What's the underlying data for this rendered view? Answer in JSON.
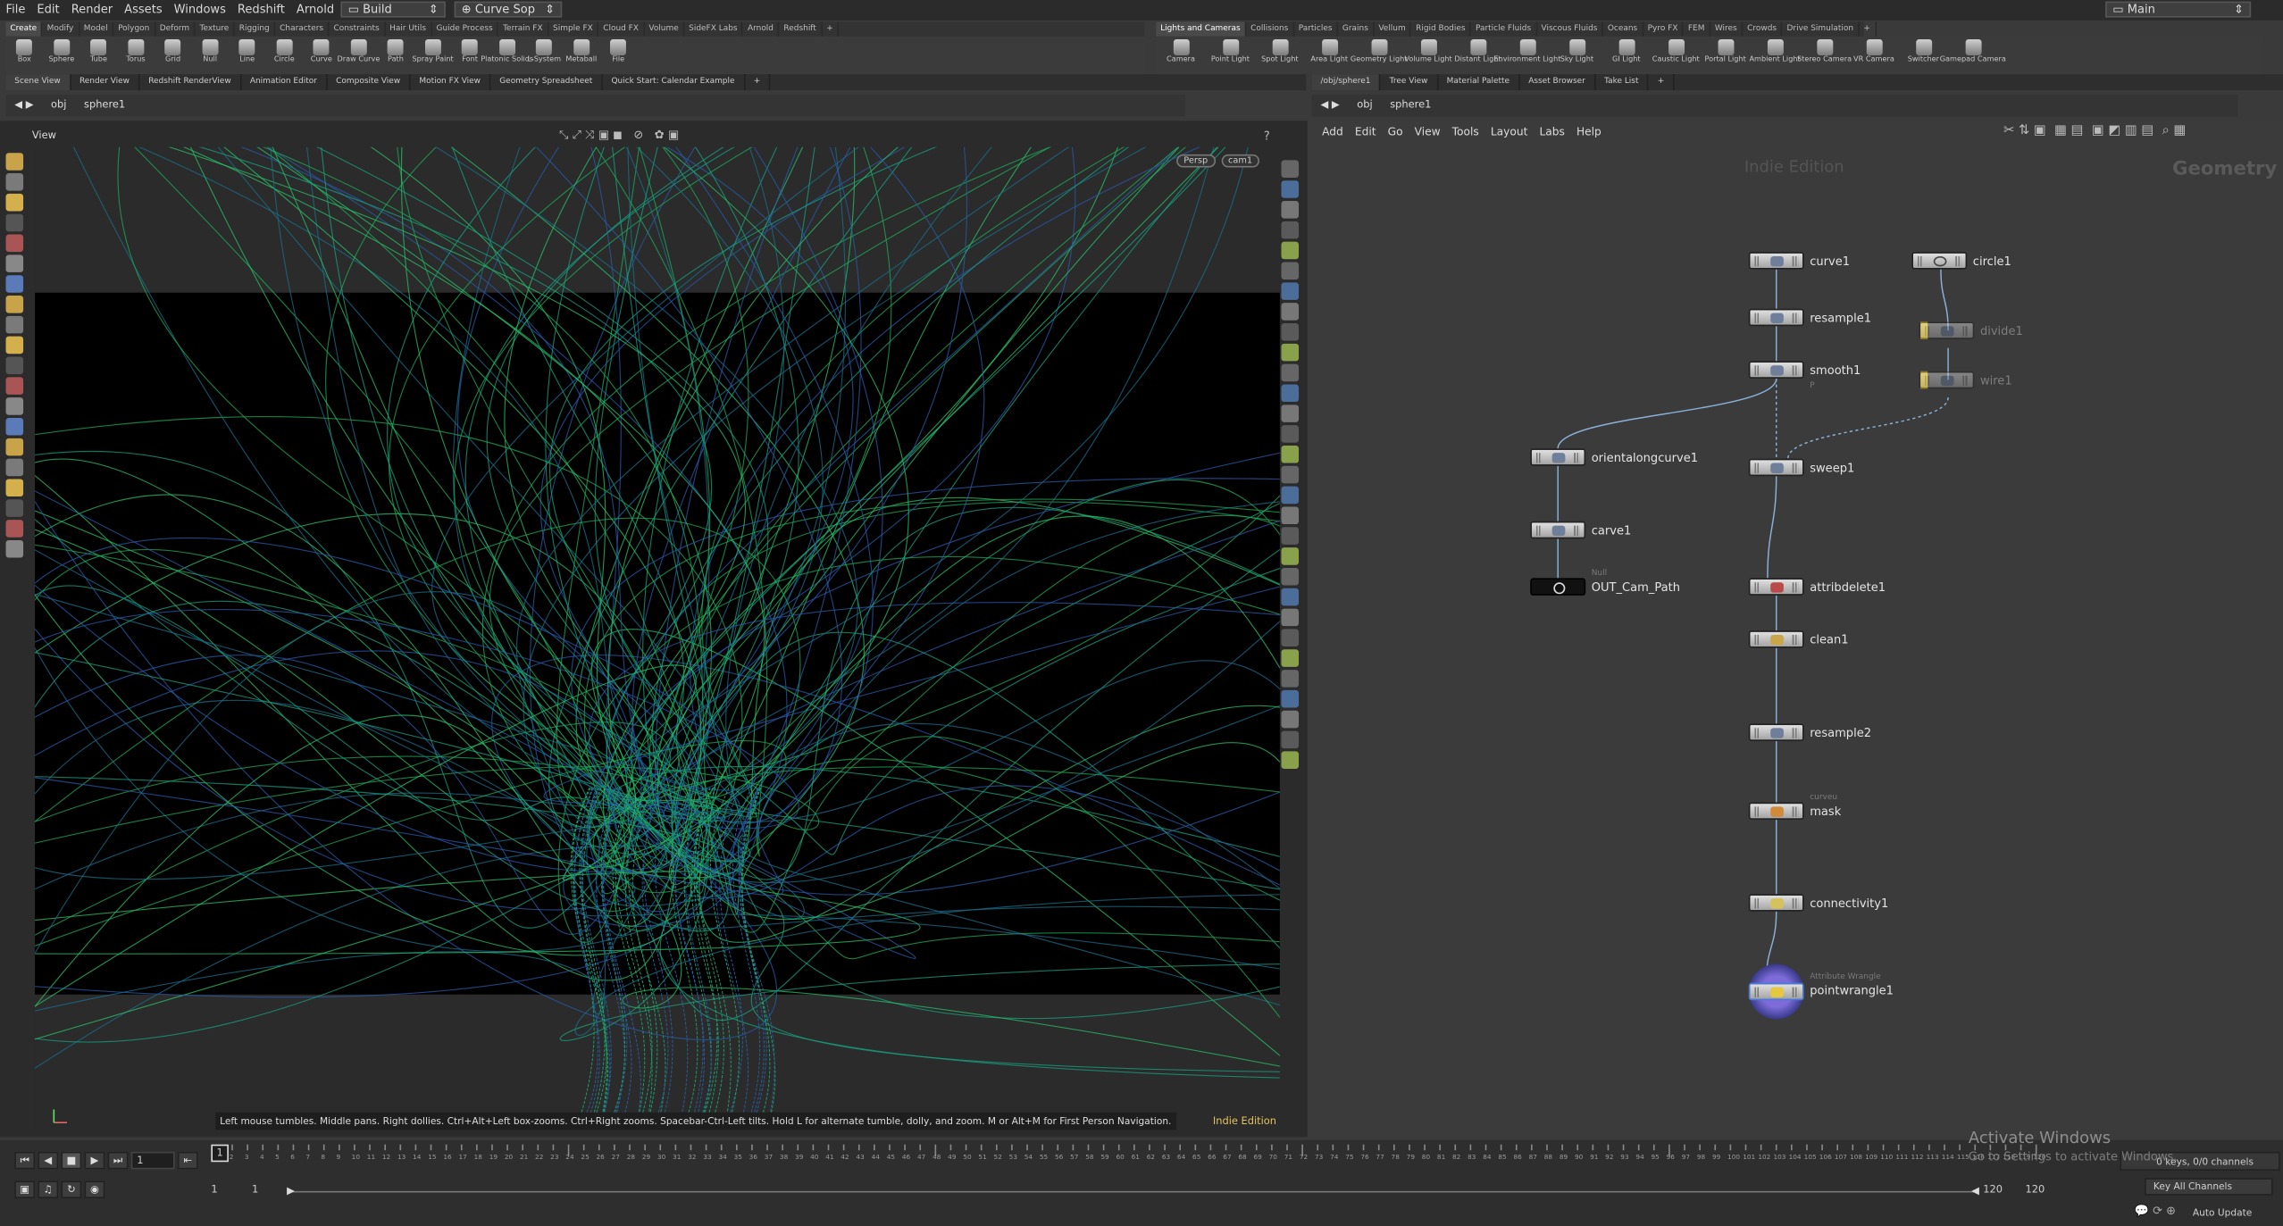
{
  "menubar": {
    "items": [
      "File",
      "Edit",
      "Render",
      "Assets",
      "Windows",
      "Redshift",
      "Arnold",
      "Help"
    ],
    "desktop": "Build",
    "context": "Curve Sop",
    "main": "Main"
  },
  "shelf_left": {
    "tabs": [
      "Create",
      "Modify",
      "Model",
      "Polygon",
      "Deform",
      "Texture",
      "Rigging",
      "Characters",
      "Constraints",
      "Hair Utils",
      "Guide Process",
      "Terrain FX",
      "Simple FX",
      "Cloud FX",
      "Volume",
      "SideFX Labs",
      "Arnold",
      "Redshift"
    ],
    "tools": [
      "Box",
      "Sphere",
      "Tube",
      "Torus",
      "Grid",
      "Null",
      "Line",
      "Circle",
      "Curve",
      "Draw Curve",
      "Path",
      "Spray Paint",
      "Font",
      "Platonic Solids",
      "L-System",
      "Metaball",
      "File"
    ]
  },
  "shelf_right": {
    "tabs": [
      "Lights and Cameras",
      "Collisions",
      "Particles",
      "Grains",
      "Vellum",
      "Rigid Bodies",
      "Particle Fluids",
      "Viscous Fluids",
      "Oceans",
      "Pyro FX",
      "FEM",
      "Wires",
      "Crowds",
      "Drive Simulation"
    ],
    "tools": [
      "Camera",
      "Point Light",
      "Spot Light",
      "Area Light",
      "Geometry Light",
      "Volume Light",
      "Distant Light",
      "Environment Light",
      "Sky Light",
      "GI Light",
      "Caustic Light",
      "Portal Light",
      "Ambient Light",
      "Stereo Camera",
      "VR Camera",
      "Switcher",
      "Gamepad Camera"
    ]
  },
  "left_panes": {
    "tabs": [
      "Scene View",
      "Render View",
      "Redshift RenderView",
      "Animation Editor",
      "Composite View",
      "Motion FX View",
      "Geometry Spreadsheet",
      "Quick Start: Calendar Example"
    ],
    "path": [
      "obj",
      "sphere1"
    ]
  },
  "right_panes": {
    "tabs": [
      "/obj/sphere1",
      "Tree View",
      "Material Palette",
      "Asset Browser",
      "Take List"
    ],
    "path": [
      "obj",
      "sphere1"
    ]
  },
  "viewport": {
    "title": "View",
    "persp": "Persp",
    "camera": "cam1",
    "hint": "Left mouse tumbles. Middle pans. Right dollies. Ctrl+Alt+Left box-zooms. Ctrl+Right zooms. Spacebar-Ctrl-Left tilts. Hold L for alternate tumble, dolly, and zoom.    M or Alt+M for First Person Navigation.",
    "edition": "Indie Edition"
  },
  "network": {
    "menu": [
      "Add",
      "Edit",
      "Go",
      "View",
      "Tools",
      "Layout",
      "Labs",
      "Help"
    ],
    "watermark": "Indie Edition",
    "context": "Geometry",
    "nodes": {
      "curve1": "curve1",
      "resample1": "resample1",
      "smooth1": "smooth1",
      "smooth1_flag": "P",
      "circle1": "circle1",
      "divide1": "divide1",
      "wire1": "wire1",
      "orient": "orientalongcurve1",
      "carve1": "carve1",
      "null_type": "Null",
      "out": "OUT_Cam_Path",
      "sweep1": "sweep1",
      "attribdelete1": "attribdelete1",
      "clean1": "clean1",
      "resample2": "resample2",
      "mask_type": "curveu",
      "mask": "mask",
      "connectivity1": "connectivity1",
      "wrangle_type": "Attribute Wrangle",
      "wrangle": "pointwrangle1"
    }
  },
  "timeline": {
    "frame": "1",
    "start": "1",
    "start2": "1",
    "end": "120",
    "end2": "120",
    "ticks": [
      "1",
      "2",
      "3",
      "4",
      "5",
      "6",
      "7",
      "8",
      "9",
      "10",
      "11",
      "12",
      "13",
      "14",
      "15",
      "16",
      "17",
      "18",
      "19",
      "20",
      "21",
      "22",
      "23",
      "24",
      "25",
      "26",
      "27",
      "28",
      "29",
      "30",
      "31",
      "32",
      "33",
      "34",
      "35",
      "36",
      "37",
      "38",
      "39",
      "40",
      "41",
      "42",
      "43",
      "44",
      "45",
      "46",
      "47",
      "48",
      "49",
      "50",
      "51",
      "52",
      "53",
      "54",
      "55",
      "56",
      "57",
      "58",
      "59",
      "60",
      "61",
      "62",
      "63",
      "64",
      "65",
      "66",
      "67",
      "68",
      "69",
      "70",
      "71",
      "72",
      "73",
      "74",
      "75",
      "76",
      "77",
      "78",
      "79",
      "80",
      "81",
      "82",
      "83",
      "84",
      "85",
      "86",
      "87",
      "88",
      "89",
      "90",
      "91",
      "92",
      "93",
      "94",
      "95",
      "96",
      "97",
      "98",
      "99",
      "100",
      "101",
      "102",
      "103",
      "104",
      "105",
      "106",
      "107",
      "108",
      "109",
      "110",
      "111",
      "112",
      "113",
      "114",
      "115",
      "116",
      "117",
      "118",
      "119",
      "120"
    ],
    "keys": "0 keys, 0/0 channels",
    "key_all": "Key All Channels",
    "auto_update": "Auto Update"
  },
  "activate": {
    "title": "Activate Windows",
    "sub": "Go to Settings to activate Windows."
  }
}
